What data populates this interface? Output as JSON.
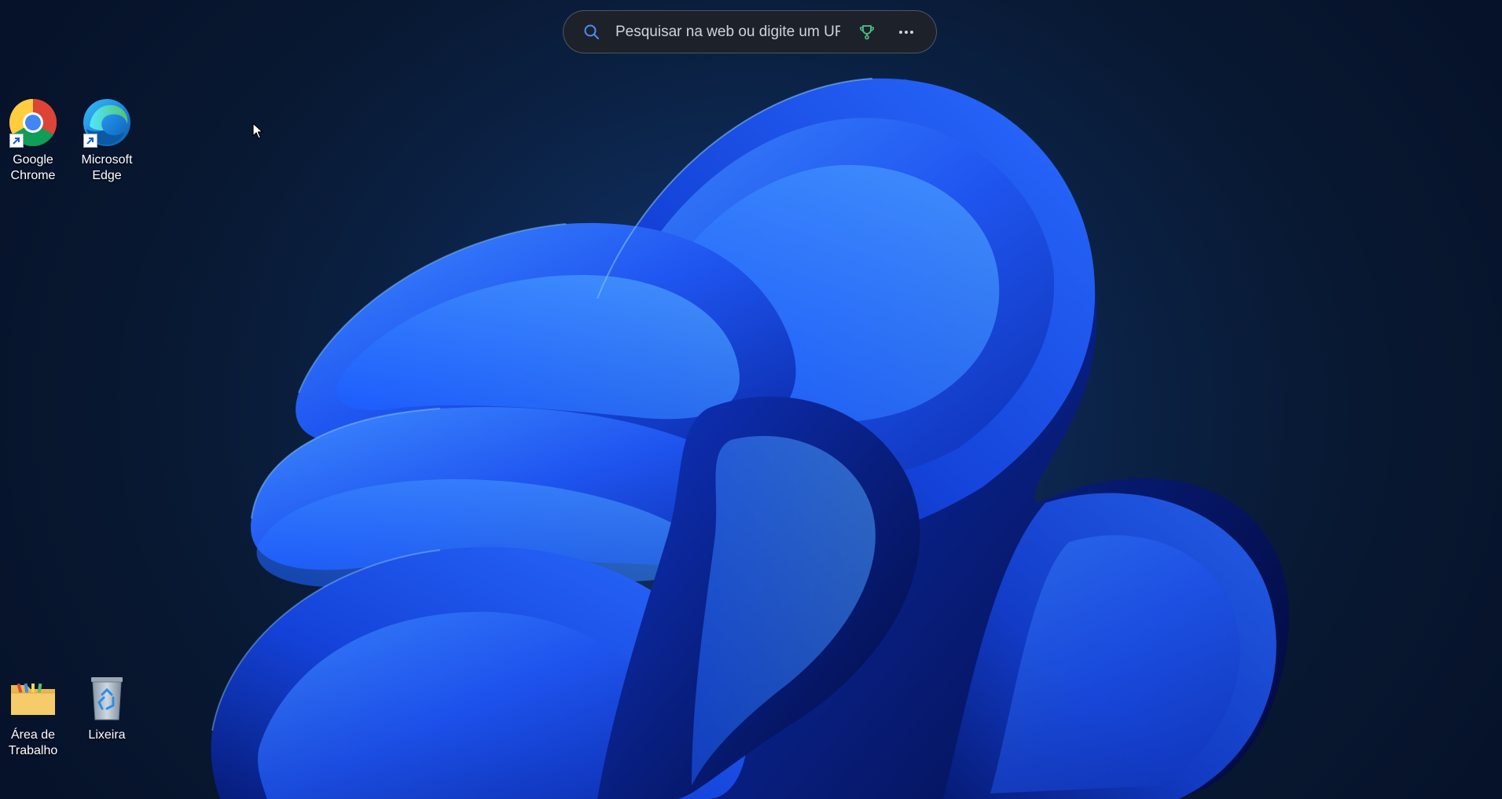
{
  "search": {
    "placeholder": "Pesquisar na web ou digite um URL",
    "value": ""
  },
  "desktop": {
    "icons": [
      {
        "label": "Google\nChrome",
        "icon": "chrome-icon",
        "shortcut": true
      },
      {
        "label": "Microsoft\nEdge",
        "icon": "edge-icon",
        "shortcut": true
      },
      {
        "label": "Área de\nTrabalho",
        "icon": "folder-icon",
        "shortcut": false
      },
      {
        "label": "Lixeira",
        "icon": "recycle-bin-icon",
        "shortcut": false
      }
    ]
  },
  "colors": {
    "background": "#0a1f3f",
    "bloom": "#1e5aff",
    "bloom_highlight": "#4aa3ff",
    "search_bg": "#202228"
  }
}
